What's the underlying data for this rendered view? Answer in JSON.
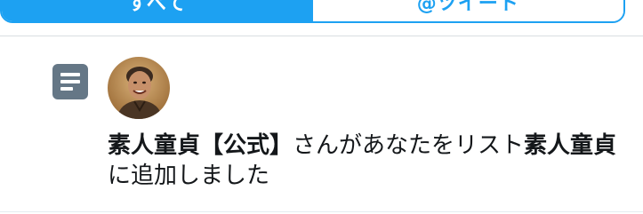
{
  "tabs": [
    {
      "label": "すべて",
      "active": true
    },
    {
      "label": "@ツイート",
      "active": false
    }
  ],
  "notification": {
    "type_icon": "list-icon",
    "avatar_icon": "user-avatar",
    "user_name": "素人童貞【公式】",
    "text_mid": "さんがあなたをリスト",
    "list_name": "素人童貞",
    "text_end": "に追加しました"
  },
  "colors": {
    "accent": "#1da1f2",
    "icon_gray": "#657786",
    "text": "#14171a",
    "divider": "#d9dde1"
  }
}
